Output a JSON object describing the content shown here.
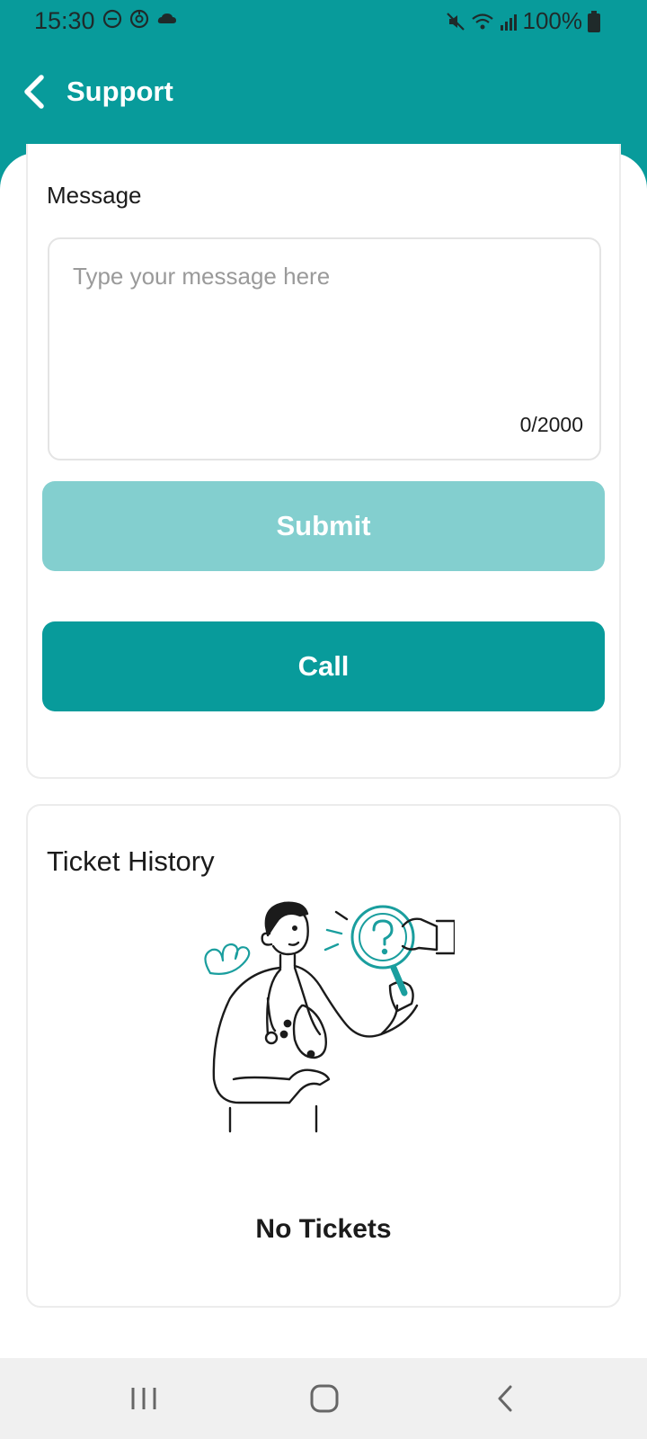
{
  "status_bar": {
    "time": "15:30",
    "battery": "100%",
    "left_icons": [
      "do-not-disturb-icon",
      "vpn-icon",
      "cloud-icon"
    ],
    "right_icons": [
      "mute-icon",
      "wifi-icon",
      "signal-icon",
      "battery-icon"
    ]
  },
  "header": {
    "title": "Support",
    "back_icon": "chevron-left-icon"
  },
  "message_form": {
    "label": "Message",
    "placeholder": "Type your message here",
    "value": "",
    "char_count": "0/2000",
    "submit_label": "Submit",
    "call_label": "Call"
  },
  "ticket_history": {
    "title": "Ticket History",
    "empty_text": "No Tickets",
    "illustration": "doctor-with-magnifier-illustration"
  },
  "nav_bar": {
    "items": [
      "recents-icon",
      "home-icon",
      "back-icon"
    ]
  },
  "colors": {
    "primary": "#089b9b",
    "primary_disabled": "#83cfcf",
    "nav_bg": "#f0f0f0"
  }
}
